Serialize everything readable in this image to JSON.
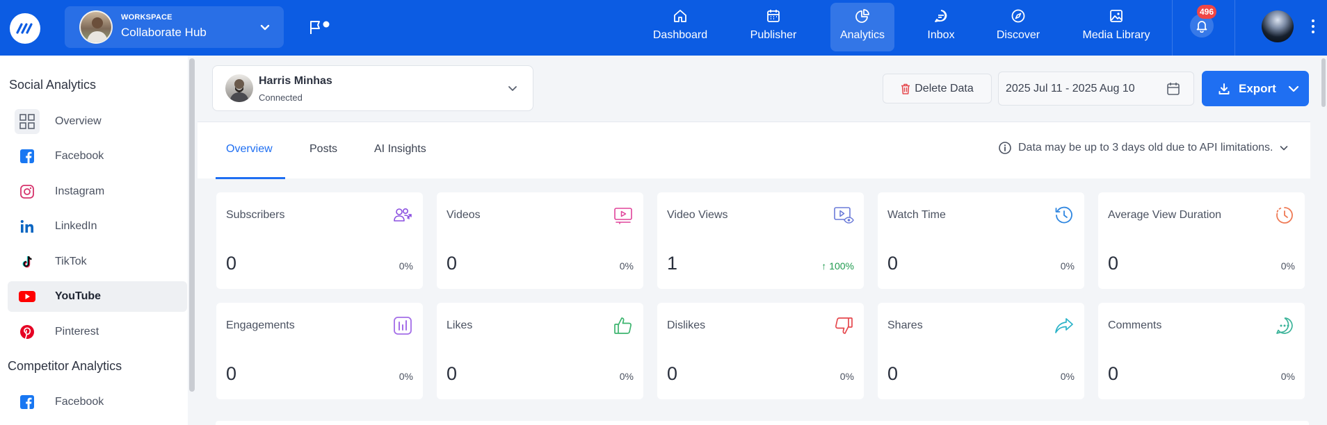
{
  "workspace": {
    "label": "WORKSPACE",
    "name": "Collaborate Hub"
  },
  "nav": {
    "items": [
      {
        "label": "Dashboard",
        "icon": "home-icon"
      },
      {
        "label": "Publisher",
        "icon": "calendar-icon"
      },
      {
        "label": "Analytics",
        "icon": "pie-chart-icon",
        "active": true
      },
      {
        "label": "Inbox",
        "icon": "chat-icon"
      },
      {
        "label": "Discover",
        "icon": "compass-icon"
      },
      {
        "label": "Media Library",
        "icon": "image-icon"
      }
    ],
    "notifications_count": "496"
  },
  "sidebar": {
    "social_heading": "Social Analytics",
    "social_items": [
      {
        "label": "Overview",
        "icon": "grid-icon"
      },
      {
        "label": "Facebook",
        "icon": "facebook-icon"
      },
      {
        "label": "Instagram",
        "icon": "instagram-icon"
      },
      {
        "label": "LinkedIn",
        "icon": "linkedin-icon"
      },
      {
        "label": "TikTok",
        "icon": "tiktok-icon"
      },
      {
        "label": "YouTube",
        "icon": "youtube-icon",
        "active": true
      },
      {
        "label": "Pinterest",
        "icon": "pinterest-icon"
      }
    ],
    "competitor_heading": "Competitor Analytics",
    "competitor_items": [
      {
        "label": "Facebook",
        "icon": "facebook-icon"
      }
    ]
  },
  "account": {
    "name": "Harris Minhas",
    "status": "Connected"
  },
  "toolbar": {
    "delete_label": "Delete Data",
    "date_range": "2025 Jul 11 - 2025 Aug 10",
    "export_label": "Export"
  },
  "tabs": [
    {
      "label": "Overview",
      "active": true
    },
    {
      "label": "Posts"
    },
    {
      "label": "AI Insights"
    }
  ],
  "notice": "Data may be up to 3 days old due to API limitations.",
  "metrics": [
    {
      "title": "Subscribers",
      "value": "0",
      "change": "0%",
      "icon": "users-icon"
    },
    {
      "title": "Videos",
      "value": "0",
      "change": "0%",
      "icon": "video-icon"
    },
    {
      "title": "Video Views",
      "value": "1",
      "change": "100%",
      "trend": "up",
      "icon": "video-view-icon"
    },
    {
      "title": "Watch Time",
      "value": "0",
      "change": "0%",
      "icon": "history-icon"
    },
    {
      "title": "Average View Duration",
      "value": "0",
      "change": "0%",
      "icon": "timer-icon"
    },
    {
      "title": "Engagements",
      "value": "0",
      "change": "0%",
      "icon": "bar-chart-icon"
    },
    {
      "title": "Likes",
      "value": "0",
      "change": "0%",
      "icon": "thumbs-up-icon"
    },
    {
      "title": "Dislikes",
      "value": "0",
      "change": "0%",
      "icon": "thumbs-down-icon"
    },
    {
      "title": "Shares",
      "value": "0",
      "change": "0%",
      "icon": "share-icon"
    },
    {
      "title": "Comments",
      "value": "0",
      "change": "0%",
      "icon": "comment-icon"
    }
  ],
  "colors": {
    "topbar": "#0c5ce3",
    "accent": "#1f6ff2",
    "positive": "#1f9a4e",
    "badge": "#ef4646"
  }
}
